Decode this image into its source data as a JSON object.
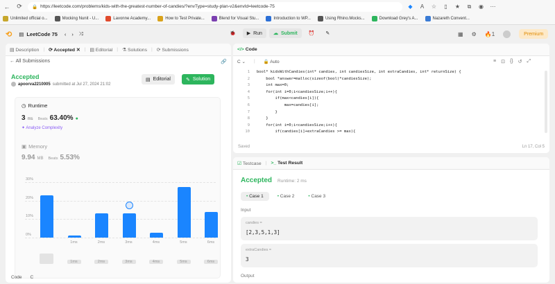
{
  "browser": {
    "url": "https://leetcode.com/problems/kids-with-the-greatest-number-of-candies/?envType=study-plan-v2&envId=leetcode-75",
    "bookmarks": [
      {
        "label": "Unlimited official o...",
        "color": "#c7a72c"
      },
      {
        "label": "Mocking Nunit - U...",
        "color": "#555555"
      },
      {
        "label": "Lavonne Academy...",
        "color": "#e04a2c"
      },
      {
        "label": "How to Test Private...",
        "color": "#d9a21b"
      },
      {
        "label": "Blend for Visual Stu...",
        "color": "#7b3fb0"
      },
      {
        "label": "Introduction to WP...",
        "color": "#2b6fd6"
      },
      {
        "label": "Using Rhino.Mocks...",
        "color": "#555555"
      },
      {
        "label": "Download Grey's A...",
        "color": "#2db55d"
      },
      {
        "label": "Nazareth Convent...",
        "color": "#3a7bd5"
      }
    ]
  },
  "header": {
    "title": "LeetCode 75",
    "run": "Run",
    "submit": "Submit",
    "streak": "1",
    "premium": "Premium"
  },
  "left": {
    "tabs": [
      "Description",
      "Accepted",
      "Editorial",
      "Solutions",
      "Submissions"
    ],
    "all_submissions": "All Submissions",
    "status": "Accepted",
    "user": "apoorva2210005",
    "submitted": "submitted at Jul 27, 2024 21:02",
    "editorial_btn": "Editorial",
    "solution_btn": "Solution",
    "runtime": {
      "label": "Runtime",
      "value": "3",
      "unit": "ms",
      "beats_label": "Beats",
      "beats": "63.40%",
      "analyze": "Analyze Complexity"
    },
    "memory": {
      "label": "Memory",
      "value": "9.94",
      "unit": "MB",
      "beats_label": "Beats",
      "beats": "5.53%"
    },
    "footer": {
      "code": "Code",
      "lang": "C"
    }
  },
  "chart_data": {
    "type": "bar",
    "y_ticks": [
      "30%",
      "20%",
      "10%",
      "0%"
    ],
    "ylim": [
      0,
      30
    ],
    "values": [
      23,
      1,
      13,
      13,
      2.5,
      27.5,
      14
    ],
    "x_labels": [
      "",
      "1ms",
      "2ms",
      "3ms",
      "4ms",
      "5ms",
      "6ms"
    ],
    "highlight_index": 3,
    "color": "#1a85ff"
  },
  "code": {
    "title": "Code",
    "lang": "C",
    "mode": "Auto",
    "status": "Saved",
    "position": "Ln 17, Col 5",
    "lines": [
      "bool* kidsWithCandies(int* candies, int candiesSize, int extraCandies, int* returnSize) {",
      "    bool *answer=malloc(sizeof(bool)*candiesSize);",
      "    int max=0;",
      "    for(int i=0;i<candiesSize;i++){",
      "        if(max<candies[i]){",
      "            max=candies[i];",
      "        }",
      "    }",
      "    for(int i=0;i<candiesSize;i++){",
      "        if(candies[i]+extraCandies >= max){"
    ]
  },
  "result": {
    "tabs": [
      "Testcase",
      "Test Result"
    ],
    "status": "Accepted",
    "runtime": "Runtime: 2 ms",
    "cases": [
      "Case 1",
      "Case 2",
      "Case 3"
    ],
    "input_label": "Input",
    "candies_label": "candies =",
    "candies_value": "[2,3,5,1,3]",
    "extra_label": "extraCandies =",
    "extra_value": "3",
    "output_label": "Output"
  }
}
